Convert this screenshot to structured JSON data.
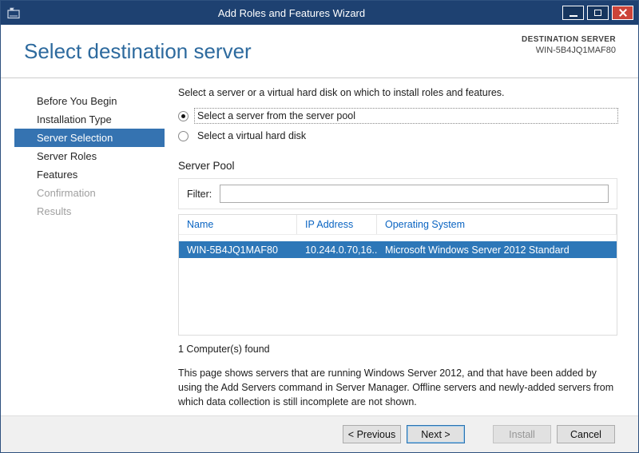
{
  "window": {
    "title": "Add Roles and Features Wizard"
  },
  "header": {
    "title": "Select destination server",
    "destination_label": "DESTINATION SERVER",
    "destination_server": "WIN-5B4JQ1MAF80"
  },
  "sidebar": {
    "items": [
      {
        "label": "Before You Begin",
        "state": "normal"
      },
      {
        "label": "Installation Type",
        "state": "normal"
      },
      {
        "label": "Server Selection",
        "state": "selected"
      },
      {
        "label": "Server Roles",
        "state": "normal"
      },
      {
        "label": "Features",
        "state": "normal"
      },
      {
        "label": "Confirmation",
        "state": "disabled"
      },
      {
        "label": "Results",
        "state": "disabled"
      }
    ]
  },
  "main": {
    "intro": "Select a server or a virtual hard disk on which to install roles and features.",
    "radios": [
      {
        "label": "Select a server from the server pool",
        "checked": true
      },
      {
        "label": "Select a virtual hard disk",
        "checked": false
      }
    ],
    "server_pool_label": "Server Pool",
    "filter": {
      "label": "Filter:",
      "value": ""
    },
    "table": {
      "columns": [
        "Name",
        "IP Address",
        "Operating System"
      ],
      "rows": [
        {
          "name": "WIN-5B4JQ1MAF80",
          "ip": "10.244.0.70,16...",
          "os": "Microsoft Windows Server 2012 Standard",
          "selected": true
        }
      ]
    },
    "count_text": "1 Computer(s) found",
    "description": "This page shows servers that are running Windows Server 2012, and that have been added by using the Add Servers command in Server Manager. Offline servers and newly-added servers from which data collection is still incomplete are not shown."
  },
  "footer": {
    "buttons": {
      "previous": "< Previous",
      "next": "Next >",
      "install": "Install",
      "cancel": "Cancel"
    }
  },
  "colors": {
    "titlebar": "#1e4171",
    "heading": "#2d6a9e",
    "nav_selected": "#3573b1",
    "row_selected": "#2d77b8",
    "table_header_text": "#0a64c2",
    "close_button": "#cc4439"
  }
}
